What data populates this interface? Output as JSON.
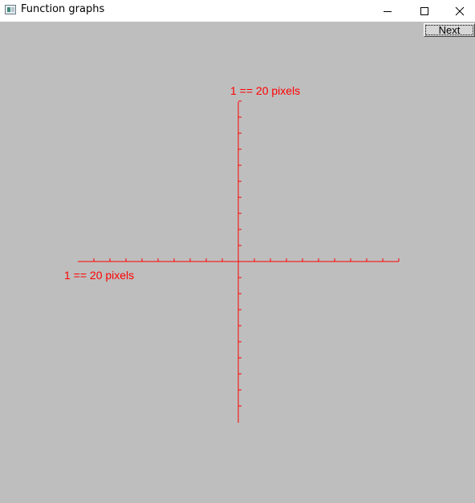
{
  "window": {
    "title": "Function graphs",
    "minimize_icon": "minimize-icon",
    "maximize_icon": "maximize-icon",
    "close_icon": "close-icon"
  },
  "toolbar": {
    "next_label": "Next"
  },
  "graph": {
    "x_axis_label": "1 == 20 pixels",
    "y_axis_label": "1 == 20 pixels",
    "scale_pixels_per_unit": 20,
    "x_range": [
      -10,
      10
    ],
    "y_range": [
      -10,
      10
    ],
    "axis_color": "#ff0000",
    "background_color": "#bebebe"
  }
}
